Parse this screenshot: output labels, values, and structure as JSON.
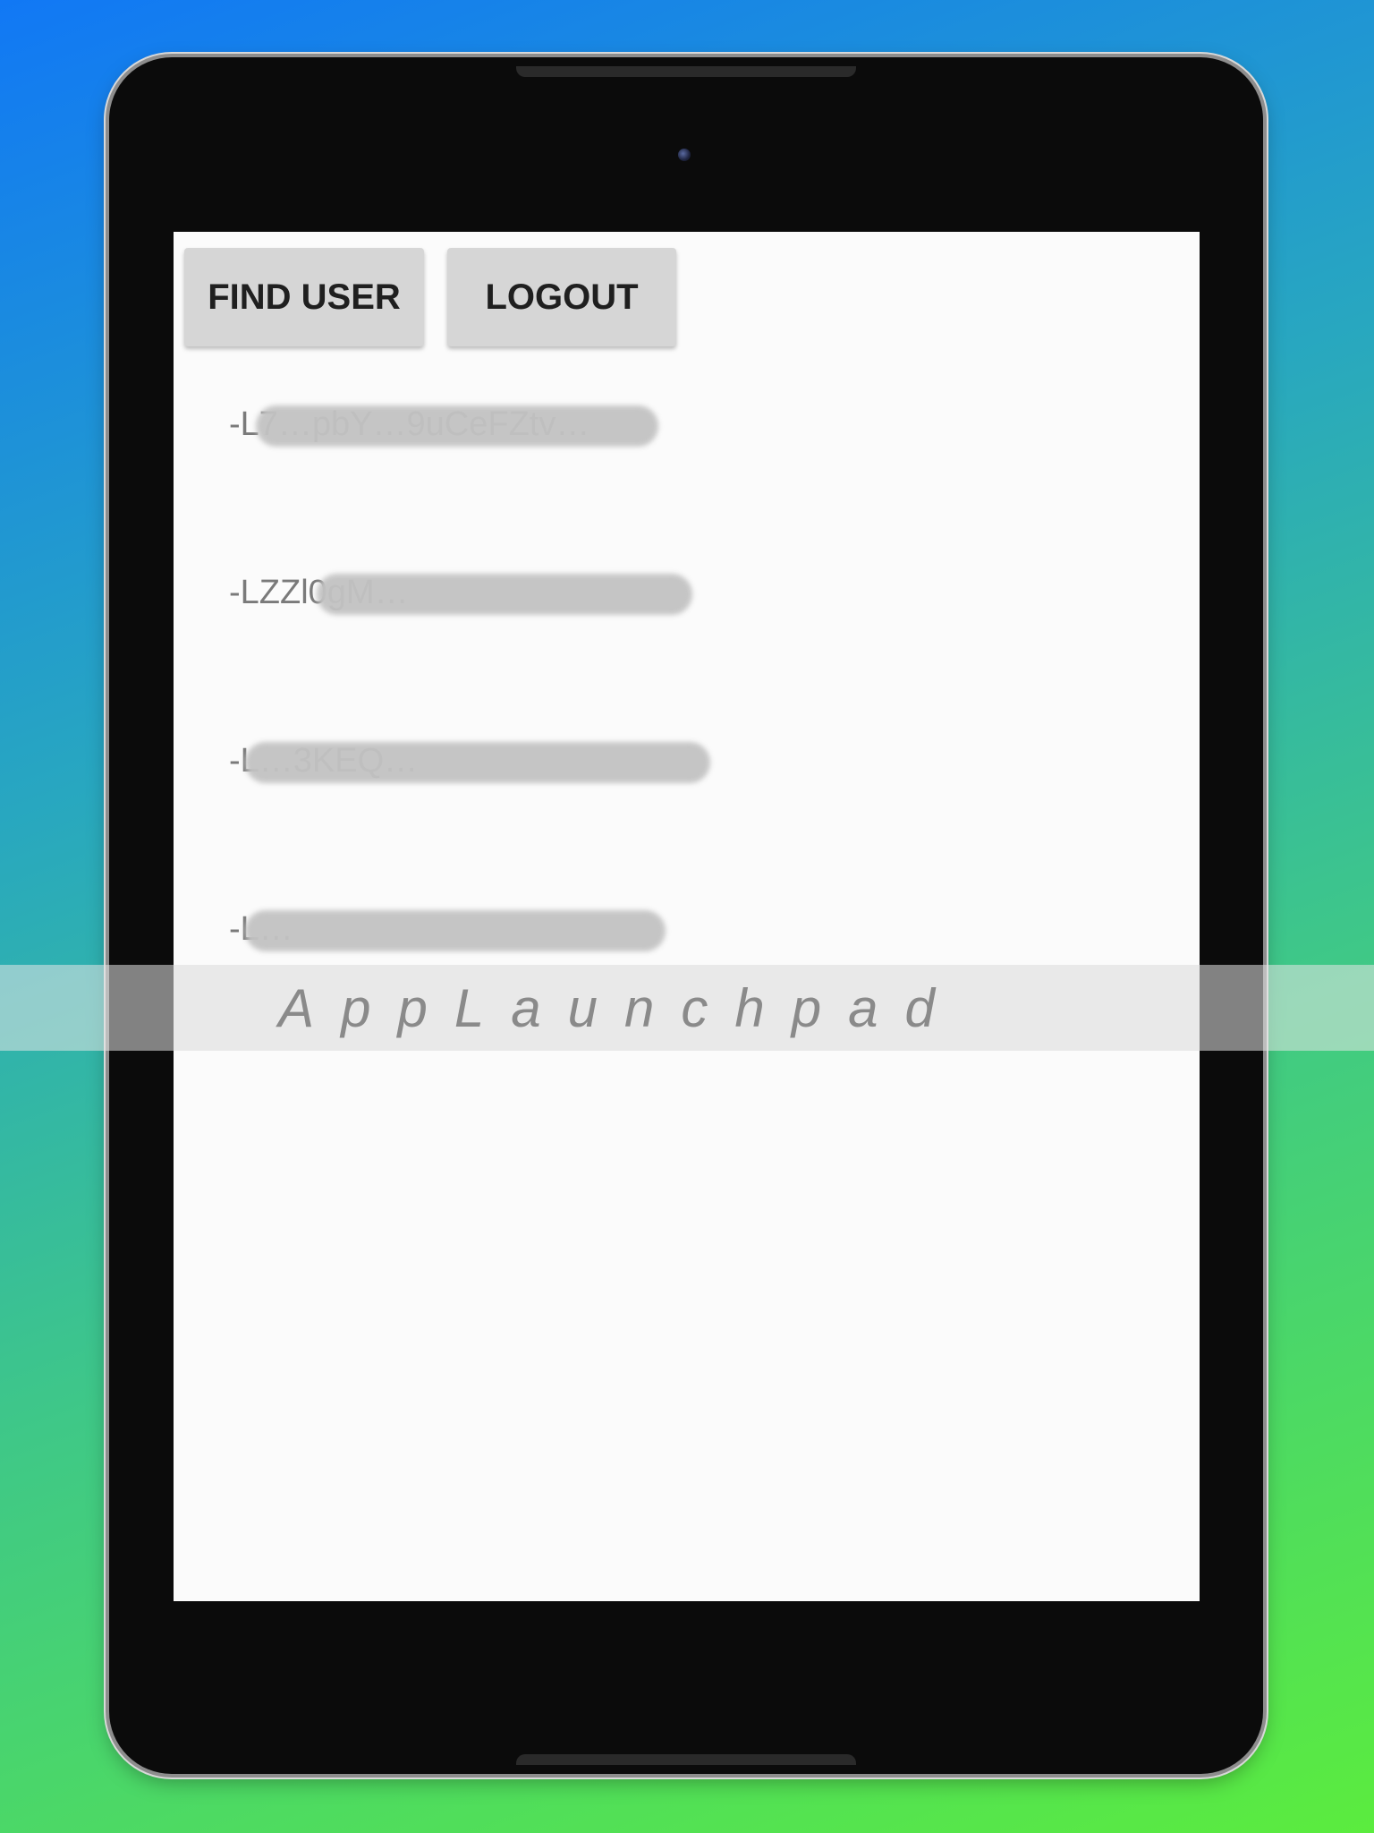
{
  "toolbar": {
    "find_user_label": "FIND USER",
    "logout_label": "LOGOUT"
  },
  "users": [
    {
      "id_text": "-L7…pbY…9uCeFZtv…"
    },
    {
      "id_text": "-LZZl0gM…"
    },
    {
      "id_text": "-L…3KEQ…"
    },
    {
      "id_text": "-L…"
    }
  ],
  "watermark": {
    "text": "AppLaunchpad"
  }
}
